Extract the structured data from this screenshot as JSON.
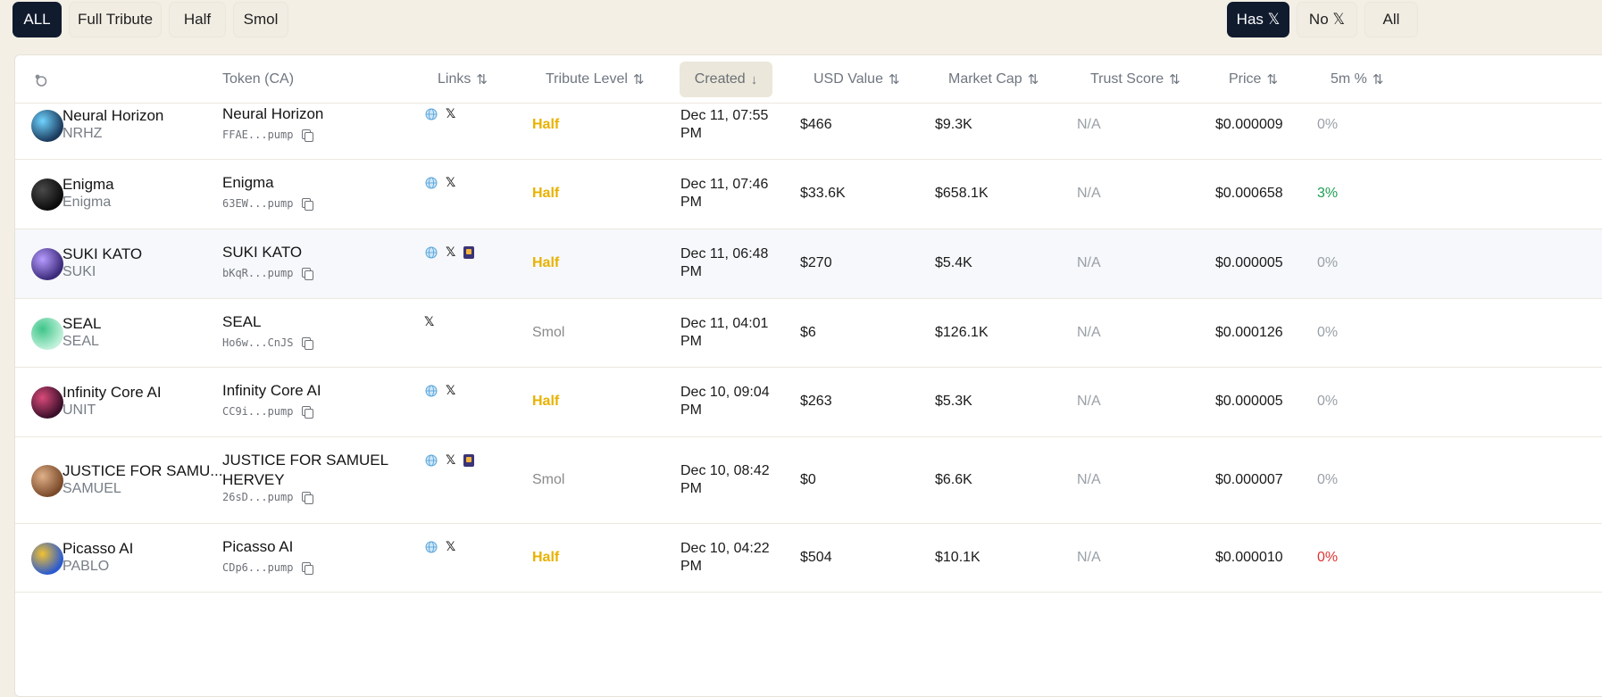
{
  "filters": {
    "left": [
      {
        "label": "ALL",
        "active": true
      },
      {
        "label": "Full Tribute",
        "active": false
      },
      {
        "label": "Half",
        "active": false
      },
      {
        "label": "Smol",
        "active": false
      }
    ],
    "right": [
      {
        "label": "Has 𝕏",
        "active": true
      },
      {
        "label": "No 𝕏",
        "active": false
      },
      {
        "label": "All",
        "active": false
      }
    ]
  },
  "columns": {
    "token": "Token (CA)",
    "links": "Links",
    "tribute": "Tribute Level",
    "created": "Created",
    "usd": "USD Value",
    "mcap": "Market Cap",
    "trust": "Trust Score",
    "price": "Price",
    "pct5m": "5m %",
    "sort_both_glyph": "⇅",
    "sort_down_glyph": "↓"
  },
  "x_glyph": "𝕏",
  "colors": {
    "accent_dark": "#101b2e",
    "half": "#e8b200",
    "positive": "#1f9d55",
    "negative": "#e03131",
    "neutral": "#9aa0a6"
  },
  "rows": [
    {
      "name": "Neural Horizon",
      "symbol": "NRHZ",
      "token": "Neural Horizon",
      "ca": "FFAE...pump",
      "links": [
        "globe",
        "x"
      ],
      "tribute": "Half",
      "created": "Dec 11, 07:55 PM",
      "usd": "$466",
      "mcap": "$9.3K",
      "trust": "N/A",
      "price": "$0.000009",
      "pct": "0%",
      "pct_state": "neutral",
      "avatar": [
        "#1b3a5c",
        "#6fd3ff"
      ]
    },
    {
      "name": "Enigma",
      "symbol": "Enigma",
      "token": "Enigma",
      "ca": "63EW...pump",
      "links": [
        "globe",
        "x"
      ],
      "tribute": "Half",
      "created": "Dec 11, 07:46 PM",
      "usd": "$33.6K",
      "mcap": "$658.1K",
      "trust": "N/A",
      "price": "$0.000658",
      "pct": "3%",
      "pct_state": "positive",
      "avatar": [
        "#0b0b0b",
        "#4a4a4a"
      ]
    },
    {
      "name": "SUKI KATO",
      "symbol": "SUKI",
      "token": "SUKI KATO",
      "ca": "bKqR...pump",
      "links": [
        "globe",
        "x",
        "telegram"
      ],
      "tribute": "Half",
      "created": "Dec 11, 06:48 PM",
      "usd": "$270",
      "mcap": "$5.4K",
      "trust": "N/A",
      "price": "$0.000005",
      "pct": "0%",
      "pct_state": "neutral",
      "avatar": [
        "#3b2a7a",
        "#b79cff"
      ]
    },
    {
      "name": "SEAL",
      "symbol": "SEAL",
      "token": "SEAL",
      "ca": "Ho6w...CnJS",
      "links": [
        "x"
      ],
      "tribute": "Smol",
      "created": "Dec 11, 04:01 PM",
      "usd": "$6",
      "mcap": "$126.1K",
      "trust": "N/A",
      "price": "$0.000126",
      "pct": "0%",
      "pct_state": "neutral",
      "avatar": [
        "#bff0d9",
        "#3fc58a"
      ]
    },
    {
      "name": "Infinity Core AI",
      "symbol": "UNIT",
      "token": "Infinity Core AI",
      "ca": "CC9i...pump",
      "links": [
        "globe",
        "x"
      ],
      "tribute": "Half",
      "created": "Dec 10, 09:04 PM",
      "usd": "$263",
      "mcap": "$5.3K",
      "trust": "N/A",
      "price": "$0.000005",
      "pct": "0%",
      "pct_state": "neutral",
      "avatar": [
        "#3a0f2a",
        "#d94a7a"
      ]
    },
    {
      "name": "JUSTICE FOR SAMU...",
      "symbol": "SAMUEL",
      "token": "JUSTICE FOR SAMUEL HERVEY",
      "ca": "26sD...pump",
      "links": [
        "globe",
        "x",
        "telegram"
      ],
      "tribute": "Smol",
      "created": "Dec 10, 08:42 PM",
      "usd": "$0",
      "mcap": "$6.6K",
      "trust": "N/A",
      "price": "$0.000007",
      "pct": "0%",
      "pct_state": "neutral",
      "avatar": [
        "#7a4a2a",
        "#e0b089"
      ]
    },
    {
      "name": "Picasso AI",
      "symbol": "PABLO",
      "token": "Picasso AI",
      "ca": "CDp6...pump",
      "links": [
        "globe",
        "x"
      ],
      "tribute": "Half",
      "created": "Dec 10, 04:22 PM",
      "usd": "$504",
      "mcap": "$10.1K",
      "trust": "N/A",
      "price": "$0.000010",
      "pct": "0%",
      "pct_state": "negative",
      "avatar": [
        "#2a5ad0",
        "#f2c230"
      ]
    }
  ]
}
